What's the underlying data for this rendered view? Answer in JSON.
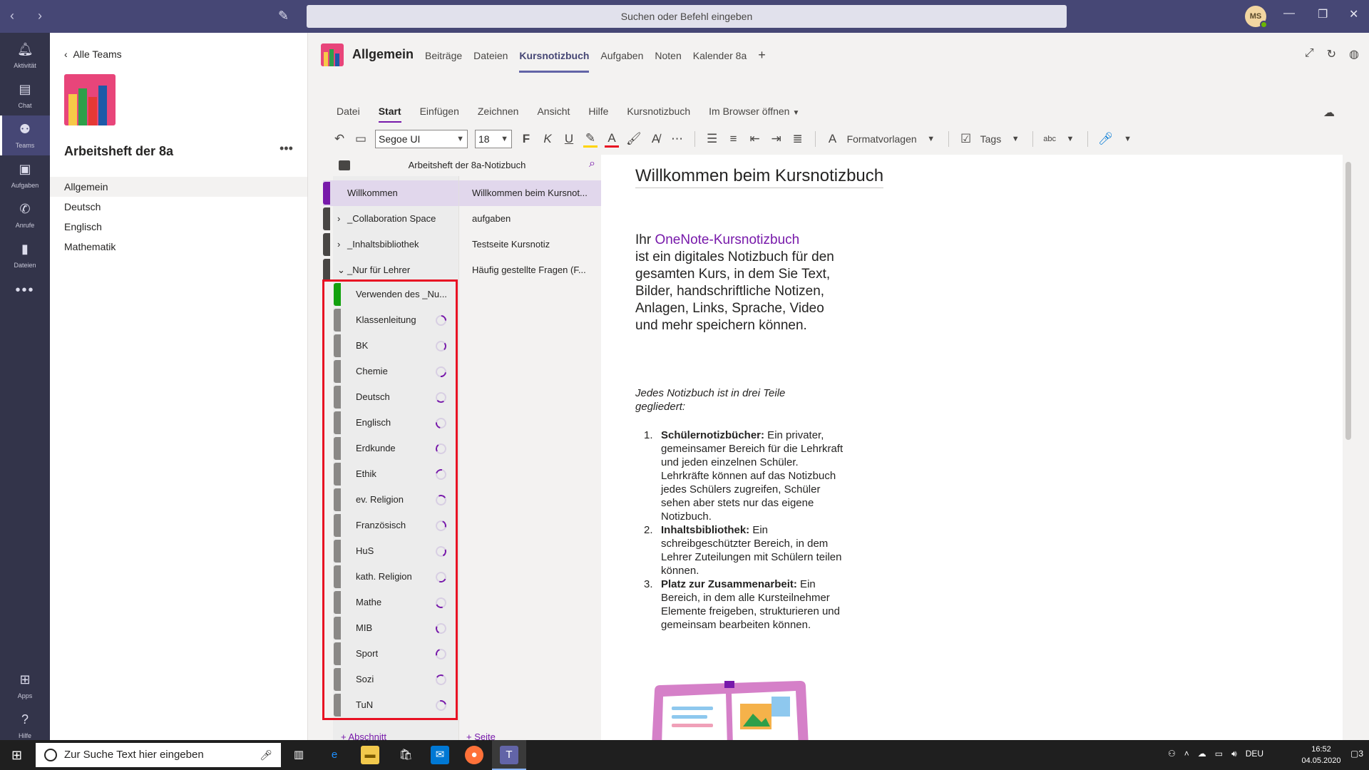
{
  "titlebar": {
    "search_placeholder": "Suchen oder Befehl eingeben",
    "avatar_initials": "MS"
  },
  "rail": {
    "items": [
      {
        "label": "Aktivität",
        "icon": "bell-icon"
      },
      {
        "label": "Chat",
        "icon": "chat-icon"
      },
      {
        "label": "Teams",
        "icon": "teams-icon"
      },
      {
        "label": "Aufgaben",
        "icon": "assignments-icon"
      },
      {
        "label": "Anrufe",
        "icon": "phone-icon"
      },
      {
        "label": "Dateien",
        "icon": "file-icon"
      }
    ],
    "apps_label": "Apps",
    "help_label": "Hilfe"
  },
  "teamlist": {
    "back_label": "Alle Teams",
    "team_name": "Arbeitsheft der 8a",
    "channels": [
      "Allgemein",
      "Deutsch",
      "Englisch",
      "Mathematik"
    ]
  },
  "header": {
    "channel_title": "Allgemein",
    "tabs": [
      "Beiträge",
      "Dateien",
      "Kursnotizbuch",
      "Aufgaben",
      "Noten",
      "Kalender 8a"
    ]
  },
  "ribbon": {
    "menu": [
      "Datei",
      "Start",
      "Einfügen",
      "Zeichnen",
      "Ansicht",
      "Hilfe",
      "Kursnotizbuch",
      "Im Browser öffnen"
    ],
    "font_name": "Segoe UI",
    "font_size": "18",
    "bold": "F",
    "italic": "K",
    "underline": "U",
    "styles_label": "Formatvorlagen",
    "tags_label": "Tags",
    "spell_label": "abc"
  },
  "notebook": {
    "title": "Arbeitsheft der 8a-Notizbuch",
    "sections_top": [
      "Willkommen",
      "_Collaboration Space",
      "_Inhaltsbibliothek",
      "_Nur für Lehrer"
    ],
    "subsections": [
      "Verwenden des _Nu...",
      "Klassenleitung",
      "BK",
      "Chemie",
      "Deutsch",
      "Englisch",
      "Erdkunde",
      "Ethik",
      "ev. Religion",
      "Französisch",
      "HuS",
      "kath. Religion",
      "Mathe",
      "MIB",
      "Sport",
      "Sozi",
      "TuN"
    ],
    "pages": [
      "Willkommen beim Kursnot...",
      "aufgaben",
      "Testseite Kursnotiz",
      "Häufig gestellte Fragen (F..."
    ],
    "add_section": "+ Abschnitt",
    "add_page": "+ Seite"
  },
  "page": {
    "title": "Willkommen beim Kursnotizbuch",
    "intro_prefix": "Ihr ",
    "intro_link": "OneNote-Kursnotizbuch",
    "intro_rest": "ist ein digitales Notizbuch für den gesamten Kurs, in dem Sie Text, Bilder, handschriftliche Notizen, Anlagen, Links, Sprache, Video und mehr speichern können.",
    "italic_note": "Jedes Notizbuch ist in drei Teile gegliedert:",
    "list": [
      {
        "num": "1.",
        "term": "Schülernotizbücher:",
        "text": " Ein privater, gemeinsamer Bereich für die Lehrkraft und jeden einzelnen Schüler. Lehrkräfte können auf das Notizbuch jedes Schülers zugreifen, Schüler sehen aber stets nur das eigene Notizbuch."
      },
      {
        "num": "2.",
        "term": "Inhaltsbibliothek:",
        "text": " Ein schreibgeschützter Bereich, in dem Lehrer Zuteilungen mit Schülern teilen können."
      },
      {
        "num": "3.",
        "term": "Platz zur Zusammenarbeit:",
        "text": " Ein Bereich, in dem alle Kursteilnehmer Elemente freigeben, strukturieren und gemeinsam bearbeiten können."
      }
    ]
  },
  "taskbar": {
    "search_placeholder": "Zur Suche Text hier eingeben",
    "lang": "DEU",
    "time": "16:52",
    "date": "04.05.2020",
    "notifications": "3"
  }
}
